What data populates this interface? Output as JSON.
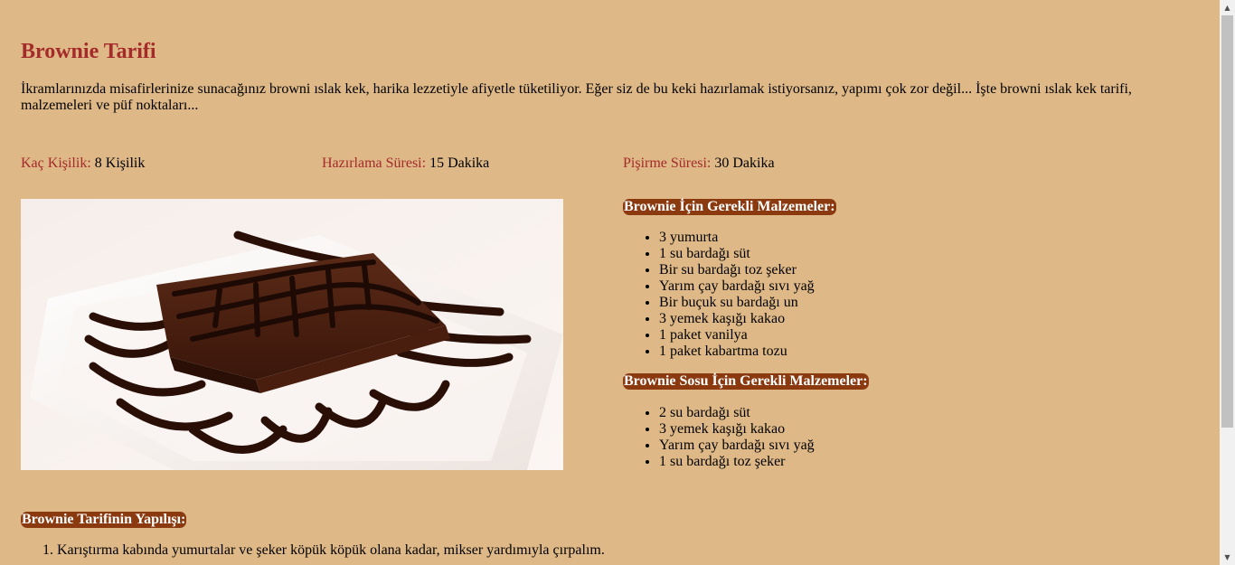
{
  "recipe": {
    "title": "Brownie Tarifi",
    "intro": "İkramlarınızda misafirlerinize sunacağınız browni ıslak kek, harika lezzetiyle afiyetle tüketiliyor. Eğer siz de bu keki hazırlamak istiyorsanız, yapımı çok zor değil... İşte browni ıslak kek tarifi, malzemeleri ve püf noktaları...",
    "meta": {
      "servings_label": "Kaç Kişilik:",
      "servings_value": "8 Kişilik",
      "prep_label": "Hazırlama Süresi:",
      "prep_value": "15 Dakika",
      "cook_label": "Pişirme Süresi:",
      "cook_value": "30 Dakika"
    },
    "image_alt": "brownie-photo",
    "ingredients": {
      "heading": "Brownie İçin Gerekli Malzemeler:",
      "items": [
        "3 yumurta",
        "1 su bardağı süt",
        "Bir su bardağı toz şeker",
        "Yarım çay bardağı sıvı yağ",
        "Bir buçuk su bardağı un",
        "3 yemek kaşığı kakao",
        "1 paket vanilya",
        "1 paket kabartma tozu"
      ]
    },
    "sauce": {
      "heading": "Brownie Sosu İçin Gerekli Malzemeler:",
      "items": [
        "2 su bardağı süt",
        "3 yemek kaşığı kakao",
        "Yarım çay bardağı sıvı yağ",
        "1 su bardağı toz şeker"
      ]
    },
    "steps": {
      "heading": "Brownie Tarifinin Yapılışı:",
      "items": [
        "Karıştırma kabında yumurtalar ve şeker köpük köpük olana kadar, mikser yardımıyla çırpalım."
      ]
    }
  },
  "colors": {
    "background": "#DEB887",
    "accent": "#A52A2A",
    "badge": "#8B3A10"
  },
  "icons": {
    "scroll_up": "scroll-up-arrow-icon",
    "scroll_down": "scroll-down-arrow-icon"
  }
}
